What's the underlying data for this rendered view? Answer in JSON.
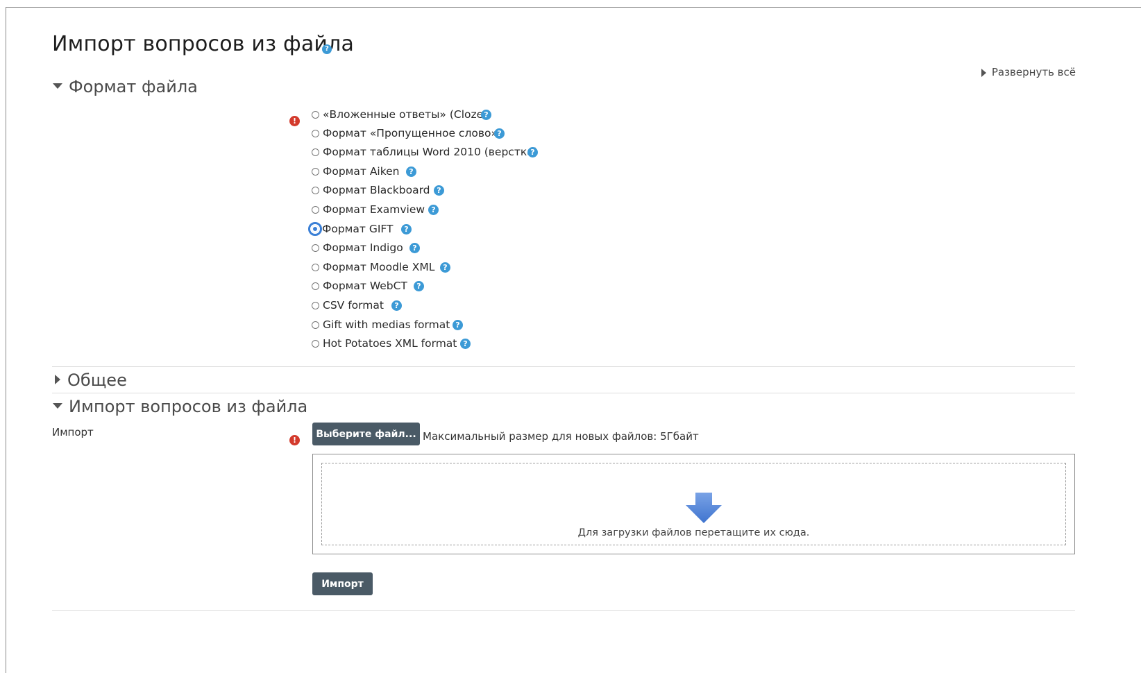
{
  "page": {
    "title": "Импорт вопросов из файла",
    "expand_all": "Развернуть всё"
  },
  "sections": {
    "format": "Формат файла",
    "general": "Общее",
    "import": "Импорт вопросов из файла"
  },
  "formats": [
    {
      "label": "«Вложенные ответы» (Cloze)",
      "checked": false
    },
    {
      "label": "Формат «Пропущенное слово»",
      "checked": false
    },
    {
      "label": "Формат таблицы Word 2010 (верстка)",
      "checked": false
    },
    {
      "label": "Формат Aiken",
      "checked": false
    },
    {
      "label": "Формат Blackboard",
      "checked": false
    },
    {
      "label": "Формат Examview",
      "checked": false
    },
    {
      "label": "Формат GIFT",
      "checked": true
    },
    {
      "label": "Формат Indigo",
      "checked": false
    },
    {
      "label": "Формат Moodle XML",
      "checked": false
    },
    {
      "label": "Формат WebCT",
      "checked": false
    },
    {
      "label": "CSV format",
      "checked": false
    },
    {
      "label": "Gift with medias format",
      "checked": false
    },
    {
      "label": "Hot Potatoes XML format",
      "checked": false
    }
  ],
  "import_form": {
    "label": "Импорт",
    "choose_file_button": "Выберите файл...",
    "max_size": "Максимальный размер для новых файлов: 5Гбайт",
    "drop_text": "Для загрузки файлов перетащите их сюда.",
    "submit_button": "Импорт"
  },
  "icons": {
    "help": "?",
    "required": "!"
  },
  "colors": {
    "help": "#3c9ad6",
    "required": "#d33a2c",
    "button": "#4a5a66",
    "selected_radio": "#3a7fd6",
    "drop_arrow": "#5b8ad6"
  }
}
